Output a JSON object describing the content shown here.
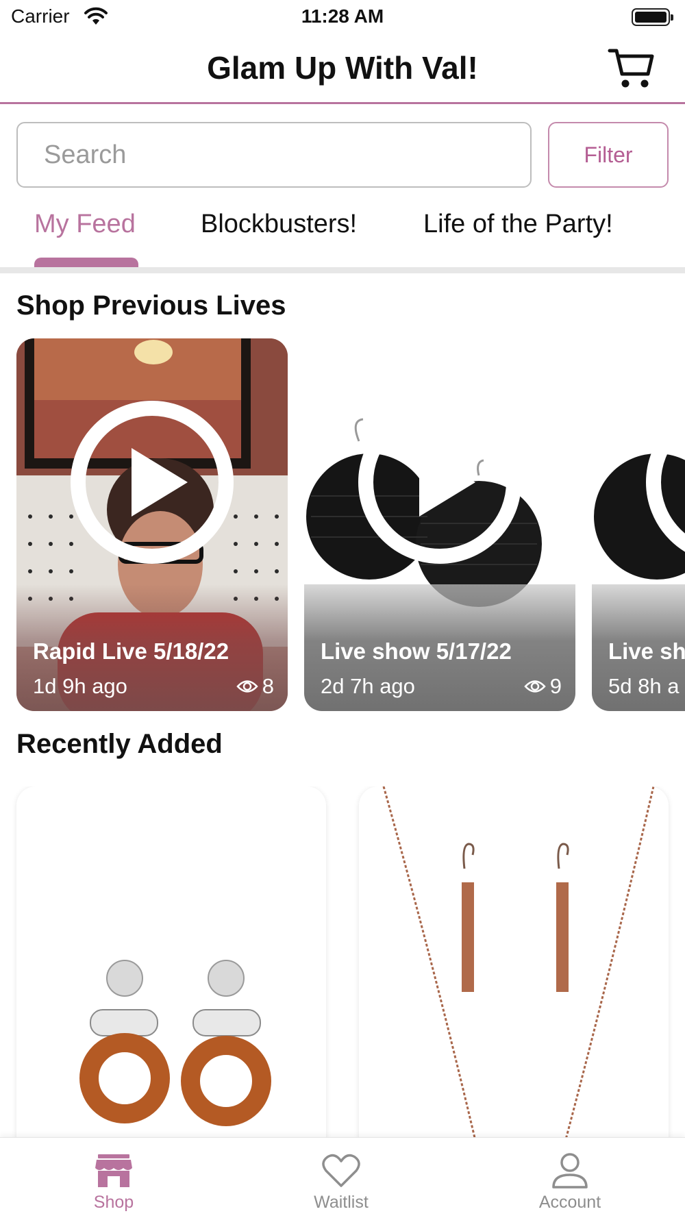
{
  "status_bar": {
    "carrier": "Carrier",
    "time": "11:28 AM",
    "battery_level": 1.0
  },
  "header": {
    "title": "Glam Up With Val!",
    "cart_icon": "cart-icon"
  },
  "search": {
    "placeholder": "Search",
    "value": "",
    "filter_label": "Filter"
  },
  "tabs": [
    {
      "label": "My Feed",
      "active": true
    },
    {
      "label": "Blockbusters!",
      "active": false
    },
    {
      "label": "Life of the Party!",
      "active": false
    }
  ],
  "sections": {
    "previous_lives": "Shop Previous Lives",
    "recently_added": "Recently Added"
  },
  "lives": [
    {
      "title": "Rapid Live 5/18/22",
      "age": "1d 9h ago",
      "views": "8"
    },
    {
      "title": "Live show 5/17/22",
      "age": "2d 7h ago",
      "views": "9"
    },
    {
      "title": "Live sho",
      "age": "5d 8h a",
      "views": ""
    }
  ],
  "tab_bar": [
    {
      "label": "Shop",
      "icon": "shop-icon",
      "active": true
    },
    {
      "label": "Waitlist",
      "icon": "heart-icon",
      "active": false
    },
    {
      "label": "Account",
      "icon": "account-icon",
      "active": false
    }
  ],
  "colors": {
    "accent": "#b8739e",
    "filter_text": "#b45e93",
    "divider": "#e7e7e7"
  }
}
